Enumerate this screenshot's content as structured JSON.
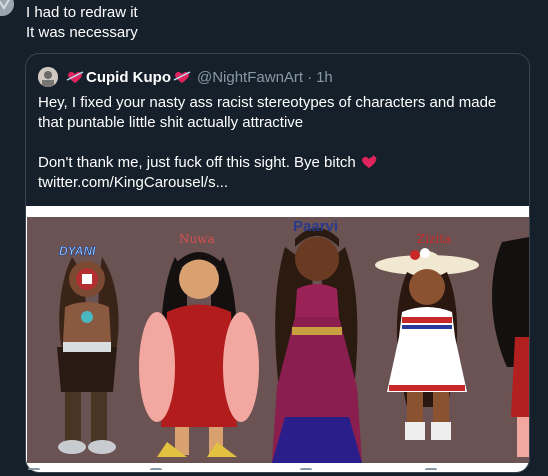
{
  "tweet": {
    "line1": "I had to redraw it",
    "line2": "It was necessary"
  },
  "quote": {
    "display_name": "Cupid Kupo",
    "handle": "@NightFawnArt",
    "separator": "·",
    "time": "1h",
    "paragraph1": "Hey, I fixed your nasty ass racist stereotypes of characters and made that puntable little shit actually attractive",
    "paragraph2": "Don't thank me, just fuck off this sight. Bye bitch",
    "link": "twitter.com/KingCarousel/s..."
  },
  "artwork": {
    "labels": {
      "dyani": "DYANI",
      "nuwa": "Nuwa",
      "paarvi": "Paarvi",
      "zizita": "Zizita"
    },
    "background_color": "#6b5253"
  },
  "colors": {
    "page_bg": "#15202b",
    "border": "#38444d",
    "secondary_text": "#8899a6",
    "heart": "#e0245e"
  },
  "icons": [
    "avatar-icon",
    "heart-icon",
    "reply-icon",
    "retweet-icon",
    "like-icon",
    "share-icon"
  ]
}
